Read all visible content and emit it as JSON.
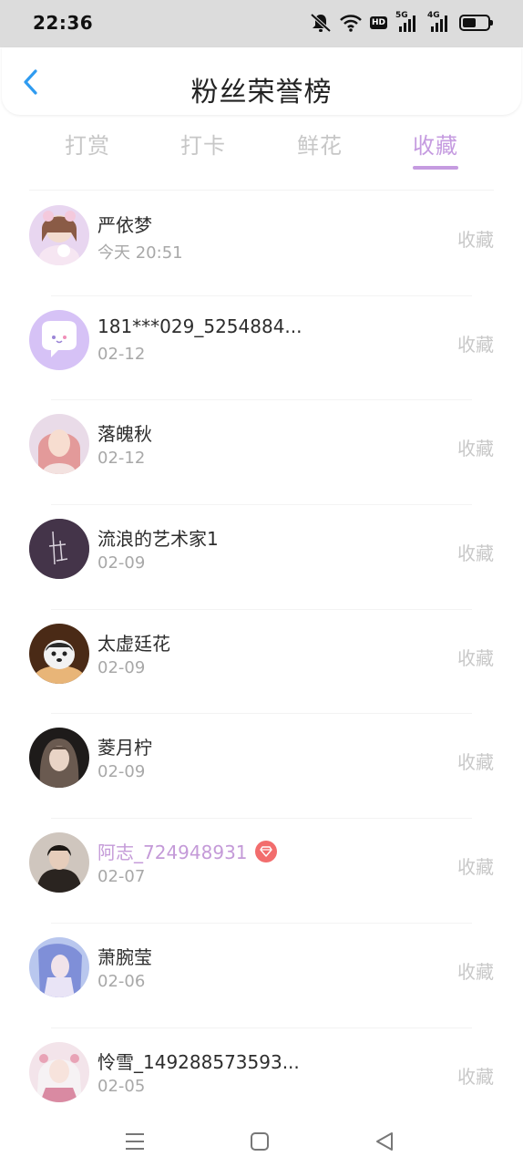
{
  "status_bar": {
    "time": "22:36",
    "icons": [
      "mute-icon",
      "wifi-icon",
      "hd-icon",
      "signal-5g-icon",
      "signal-4g-icon",
      "battery-icon"
    ],
    "hd_label": "HD",
    "net1_label": "5G",
    "net2_label": "4G",
    "battery_level": 0.55
  },
  "header": {
    "title": "粉丝荣誉榜",
    "back_icon": "chevron-left-icon"
  },
  "tabs": [
    {
      "label": "打赏",
      "active": false
    },
    {
      "label": "打卡",
      "active": false
    },
    {
      "label": "鲜花",
      "active": false
    },
    {
      "label": "收藏",
      "active": true
    }
  ],
  "colors": {
    "accent": "#c59be0",
    "back_arrow": "#2f9bf0",
    "badge": "#f26d6d"
  },
  "list": [
    {
      "name": "严依梦",
      "date": "今天 20:51",
      "action": "收藏",
      "vip": false
    },
    {
      "name": "181***029_5254884...",
      "date": "02-12",
      "action": "收藏",
      "vip": false
    },
    {
      "name": "落魄秋",
      "date": "02-12",
      "action": "收藏",
      "vip": false
    },
    {
      "name": "流浪的艺术家1",
      "date": "02-09",
      "action": "收藏",
      "vip": false
    },
    {
      "name": "太虚廷花",
      "date": "02-09",
      "action": "收藏",
      "vip": false
    },
    {
      "name": "菱月柠",
      "date": "02-09",
      "action": "收藏",
      "vip": false
    },
    {
      "name": "阿志_724948931",
      "date": "02-07",
      "action": "收藏",
      "vip": true
    },
    {
      "name": "萧腕莹",
      "date": "02-06",
      "action": "收藏",
      "vip": false
    },
    {
      "name": "怜雪_149288573593...",
      "date": "02-05",
      "action": "收藏",
      "vip": false
    }
  ],
  "nav_bar": {
    "icons": [
      "menu-icon",
      "home-icon",
      "back-icon"
    ]
  }
}
